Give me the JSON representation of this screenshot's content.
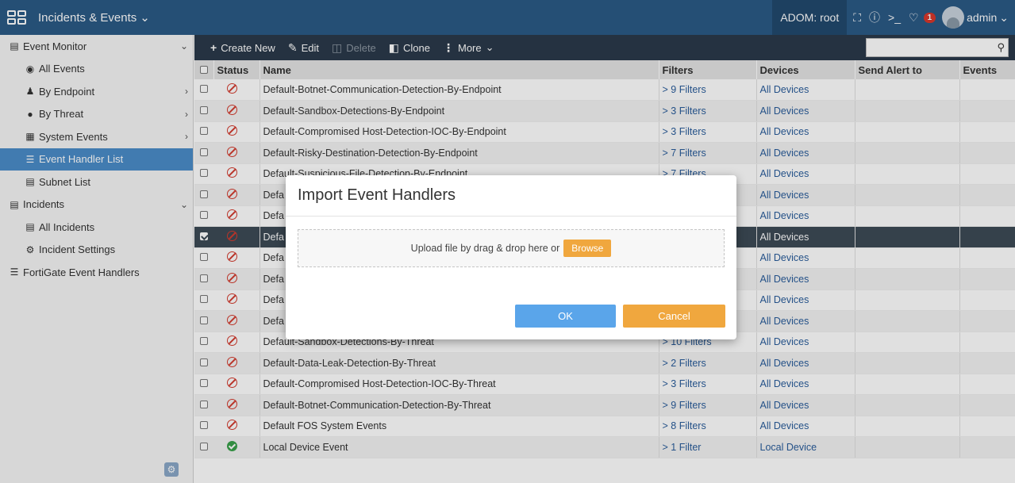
{
  "topbar": {
    "app_icon": "grid-icon",
    "title": "Incidents & Events",
    "adom": "ADOM: root",
    "notif_count": "1",
    "user": "admin"
  },
  "sidebar": {
    "items": [
      {
        "label": "Event Monitor",
        "icon": "monitor-icon"
      },
      {
        "label": "All Events",
        "icon": "globe-icon"
      },
      {
        "label": "By Endpoint",
        "icon": "users-icon"
      },
      {
        "label": "By Threat",
        "icon": "bomb-icon"
      },
      {
        "label": "System Events",
        "icon": "system-icon"
      },
      {
        "label": "Event Handler List",
        "icon": "list-icon"
      },
      {
        "label": "Subnet List",
        "icon": "subnet-icon"
      },
      {
        "label": "Incidents",
        "icon": "incidents-icon"
      },
      {
        "label": "All Incidents",
        "icon": "incidents-icon"
      },
      {
        "label": "Incident Settings",
        "icon": "settings-icon"
      },
      {
        "label": "FortiGate Event Handlers",
        "icon": "list-icon"
      }
    ]
  },
  "toolbar": {
    "create_new": "Create New",
    "edit": "Edit",
    "delete": "Delete",
    "clone": "Clone",
    "more": "More"
  },
  "table": {
    "headers": [
      "Status",
      "Name",
      "Filters",
      "Devices",
      "Send Alert to",
      "Events"
    ],
    "rows": [
      {
        "status": "disabled",
        "name": "Default-Botnet-Communication-Detection-By-Endpoint",
        "filters": "> 9 Filters",
        "devices": "All Devices"
      },
      {
        "status": "disabled",
        "name": "Default-Sandbox-Detections-By-Endpoint",
        "filters": "> 3 Filters",
        "devices": "All Devices"
      },
      {
        "status": "disabled",
        "name": "Default-Compromised Host-Detection-IOC-By-Endpoint",
        "filters": "> 3 Filters",
        "devices": "All Devices"
      },
      {
        "status": "disabled",
        "name": "Default-Risky-Destination-Detection-By-Endpoint",
        "filters": "> 7 Filters",
        "devices": "All Devices"
      },
      {
        "status": "disabled",
        "name": "Default-Suspicious-File-Detection-By-Endpoint",
        "filters": "> 7 Filters",
        "devices": "All Devices"
      },
      {
        "status": "disabled",
        "name": "Defa",
        "filters": "",
        "devices": "All Devices"
      },
      {
        "status": "disabled",
        "name": "Defa",
        "filters": "",
        "devices": "All Devices"
      },
      {
        "status": "disabled",
        "name": "Defa",
        "filters": "",
        "devices": "All Devices"
      },
      {
        "status": "disabled",
        "name": "Defa",
        "filters": "",
        "devices": "All Devices"
      },
      {
        "status": "disabled",
        "name": "Defa",
        "filters": "",
        "devices": "All Devices"
      },
      {
        "status": "disabled",
        "name": "Defa",
        "filters": "",
        "devices": "All Devices"
      },
      {
        "status": "disabled",
        "name": "Defa",
        "filters": "",
        "devices": "All Devices"
      },
      {
        "status": "disabled",
        "name": "Default-Sandbox-Detections-By-Threat",
        "filters": "> 10 Filters",
        "devices": "All Devices"
      },
      {
        "status": "disabled",
        "name": "Default-Data-Leak-Detection-By-Threat",
        "filters": "> 2 Filters",
        "devices": "All Devices"
      },
      {
        "status": "disabled",
        "name": "Default-Compromised Host-Detection-IOC-By-Threat",
        "filters": "> 3 Filters",
        "devices": "All Devices"
      },
      {
        "status": "disabled",
        "name": "Default-Botnet-Communication-Detection-By-Threat",
        "filters": "> 9 Filters",
        "devices": "All Devices"
      },
      {
        "status": "disabled",
        "name": "Default FOS System Events",
        "filters": "> 8 Filters",
        "devices": "All Devices"
      },
      {
        "status": "enabled",
        "name": "Local Device Event",
        "filters": "> 1 Filter",
        "devices": "Local Device"
      }
    ]
  },
  "modal": {
    "title": "Import Event Handlers",
    "dropzone_text": "Upload file by drag & drop here or",
    "browse": "Browse",
    "ok": "OK",
    "cancel": "Cancel"
  },
  "colors": {
    "topbar": "#2b5a86",
    "toolbar": "#2b3a4a",
    "active_item": "#4a8cc9",
    "ok_button": "#5aa5ea",
    "cancel_button": "#f0a73e"
  }
}
